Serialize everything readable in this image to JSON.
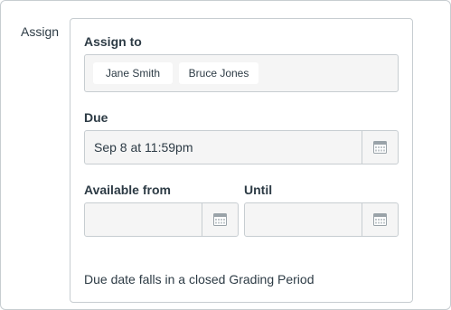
{
  "assign": {
    "row_label": "Assign",
    "assign_to_label": "Assign to",
    "assignees": [
      "Jane Smith",
      "Bruce Jones"
    ],
    "due_label": "Due",
    "due_value": "Sep 8 at 11:59pm",
    "available_from_label": "Available from",
    "available_from_value": "",
    "until_label": "Until",
    "until_value": "",
    "note": "Due date falls in a closed Grading Period"
  },
  "icons": {
    "calendar": "calendar-icon"
  },
  "colors": {
    "border": "#c7cdd1",
    "field_bg": "#f5f5f5",
    "text": "#2d3b45"
  }
}
